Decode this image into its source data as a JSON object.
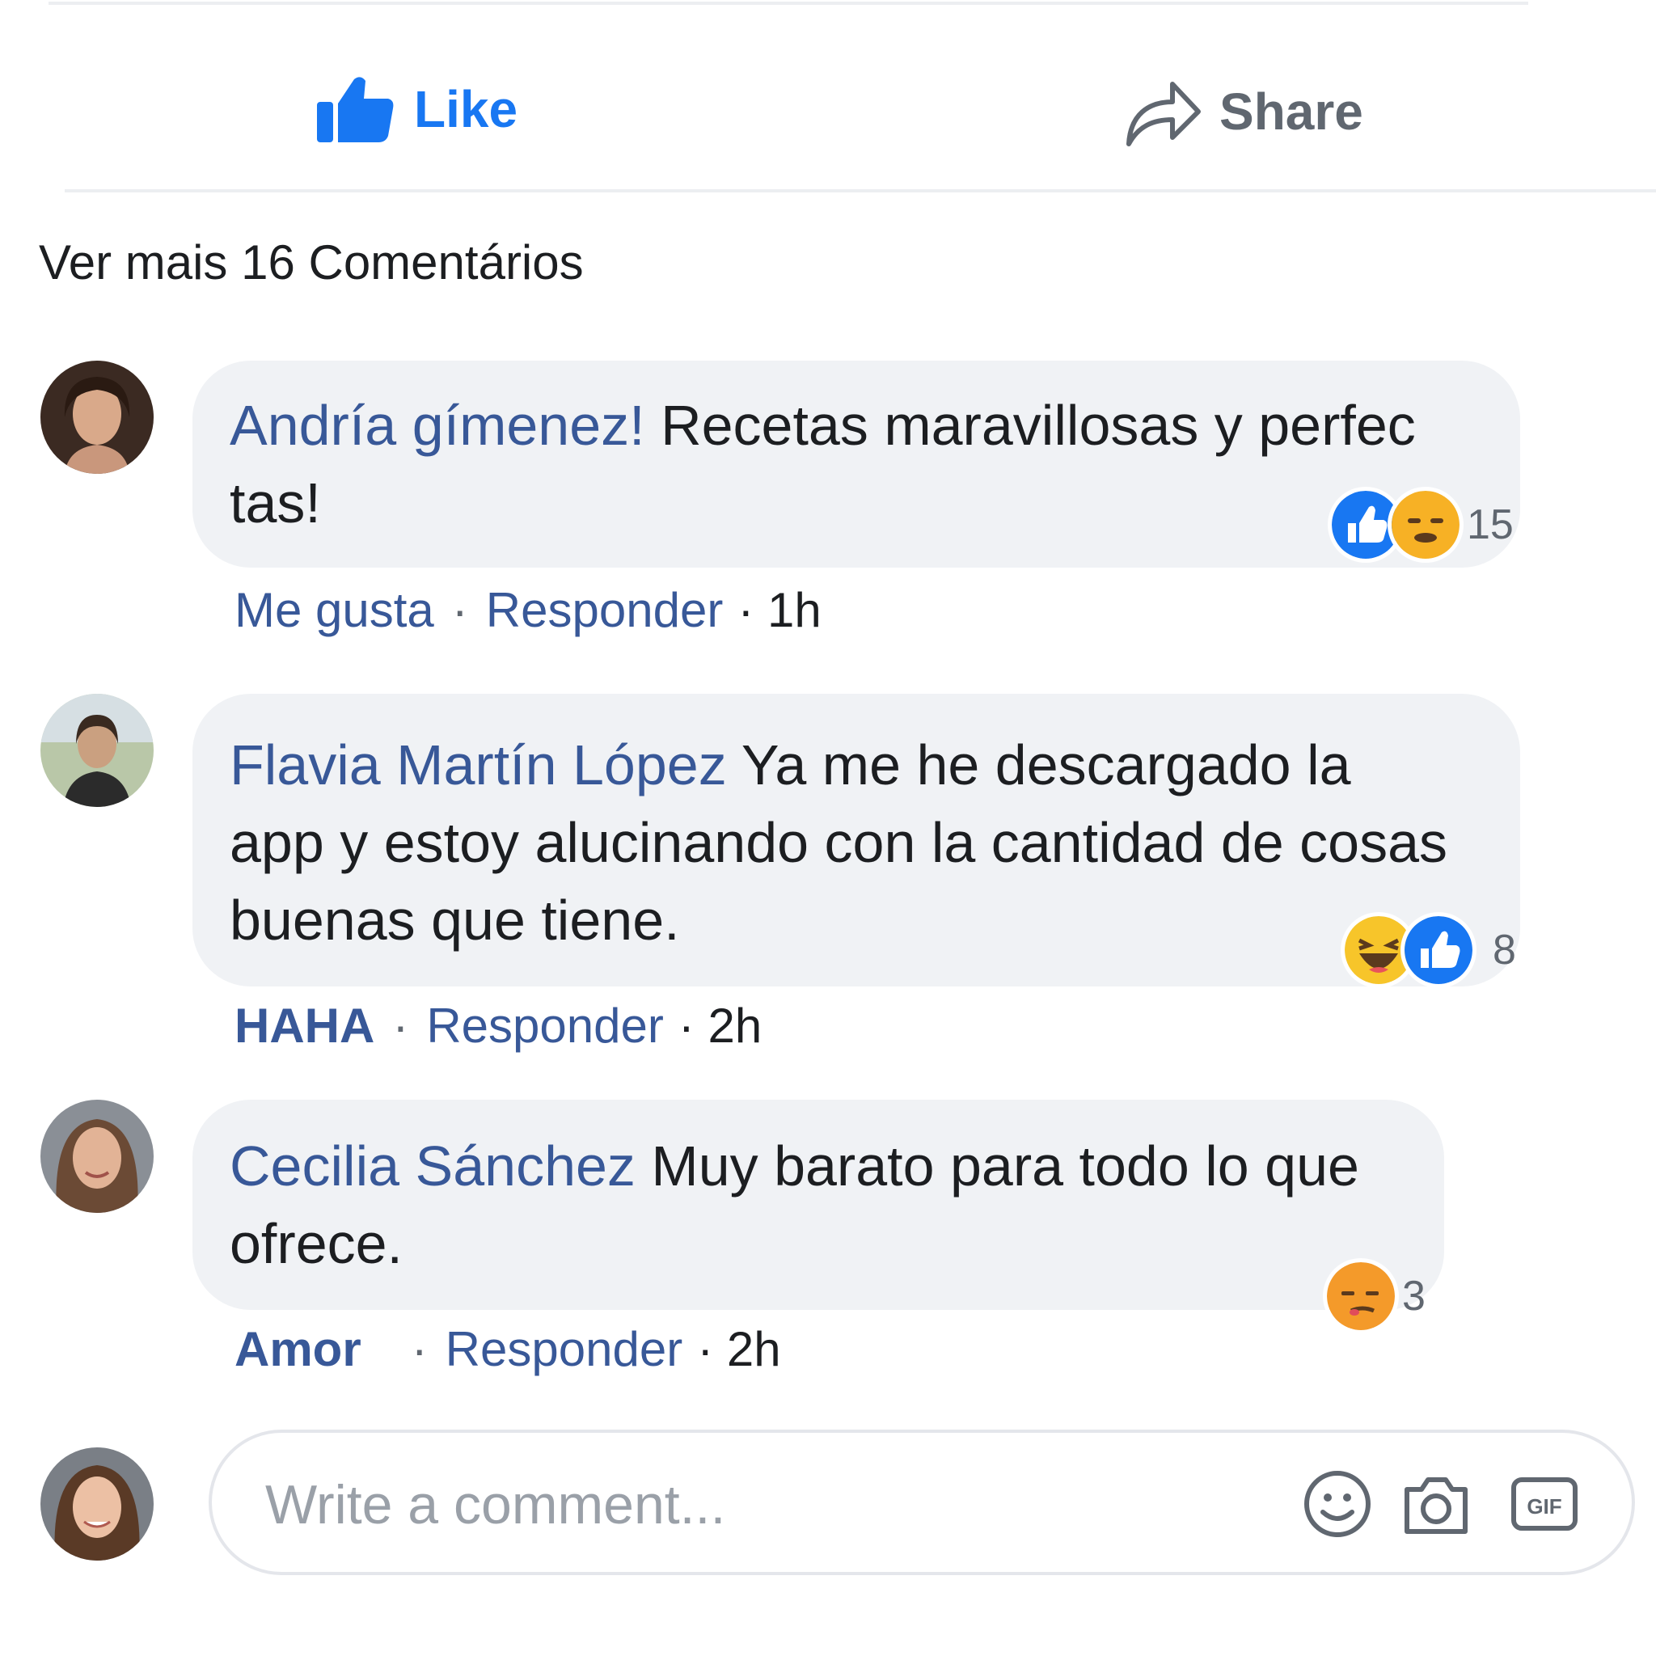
{
  "actions": {
    "like_label": "Like",
    "share_label": "Share"
  },
  "more_comments": "Ver mais 16 Comentários",
  "comments": [
    {
      "author": "Andría gímenez!",
      "line1": " Recetas maravillosas y perfec",
      "line2": "tas!",
      "reactions": [
        "like-icon",
        "angry-face-icon"
      ],
      "reaction_count": "15",
      "action_label": "Me gusta",
      "reply_label": "Responder",
      "time": "· 1h"
    },
    {
      "author": "Flavia Martín López",
      "line1": " Ya me he descargado la",
      "line2": "app y estoy alucinando con la cantidad de cosas",
      "line3": "buenas que tiene.",
      "reactions": [
        "haha-icon",
        "like-icon"
      ],
      "reaction_count": "8",
      "action_label": "HAHA",
      "reply_label": "Responder",
      "time": "· 2h"
    },
    {
      "author": "Cecilia Sánchez",
      "line1": " Muy barato para todo lo que",
      "line2": "ofrece.",
      "reactions": [
        "smirk-face-icon"
      ],
      "reaction_count": "3",
      "action_label": "Amor",
      "reply_label": "Responder",
      "time": "· 2h"
    }
  ],
  "composer": {
    "placeholder": "Write a comment..."
  },
  "colors": {
    "facebook_blue": "#1877f2",
    "author_blue": "#385898",
    "haha_yellow": "#f2c535",
    "love_pink": "#e2456d"
  }
}
